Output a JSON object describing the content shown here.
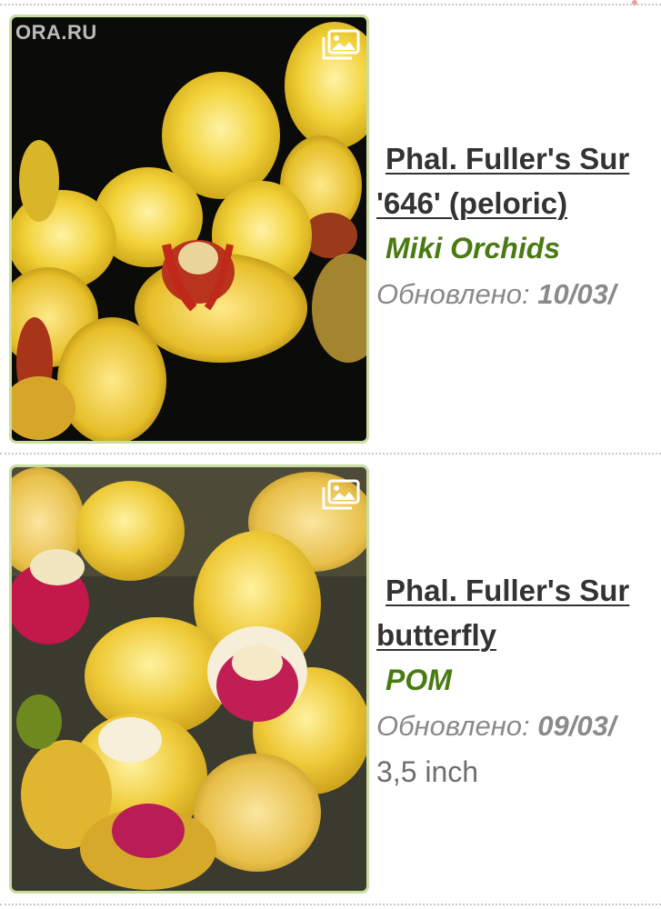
{
  "listings": [
    {
      "title_line1": "Phal. Fuller's Sur",
      "title_line2": "'646' (peloric)",
      "seller": "Miki Orchids",
      "updated_label": "Обновлено:",
      "updated_date": "10/03/",
      "image_watermark": "ORA.RU",
      "gallery_icon": "image-gallery-icon"
    },
    {
      "title_line1": "Phal. Fuller's Sur",
      "title_line2": "butterfly",
      "seller": "POM",
      "updated_label": "Обновлено:",
      "updated_date": "09/03/",
      "size": "3,5 inch",
      "gallery_icon": "image-gallery-icon"
    }
  ],
  "colors": {
    "seller": "#4a7a12",
    "thumb_border": "#c9dd9f",
    "title": "#333333",
    "meta": "#8a8a8a"
  }
}
